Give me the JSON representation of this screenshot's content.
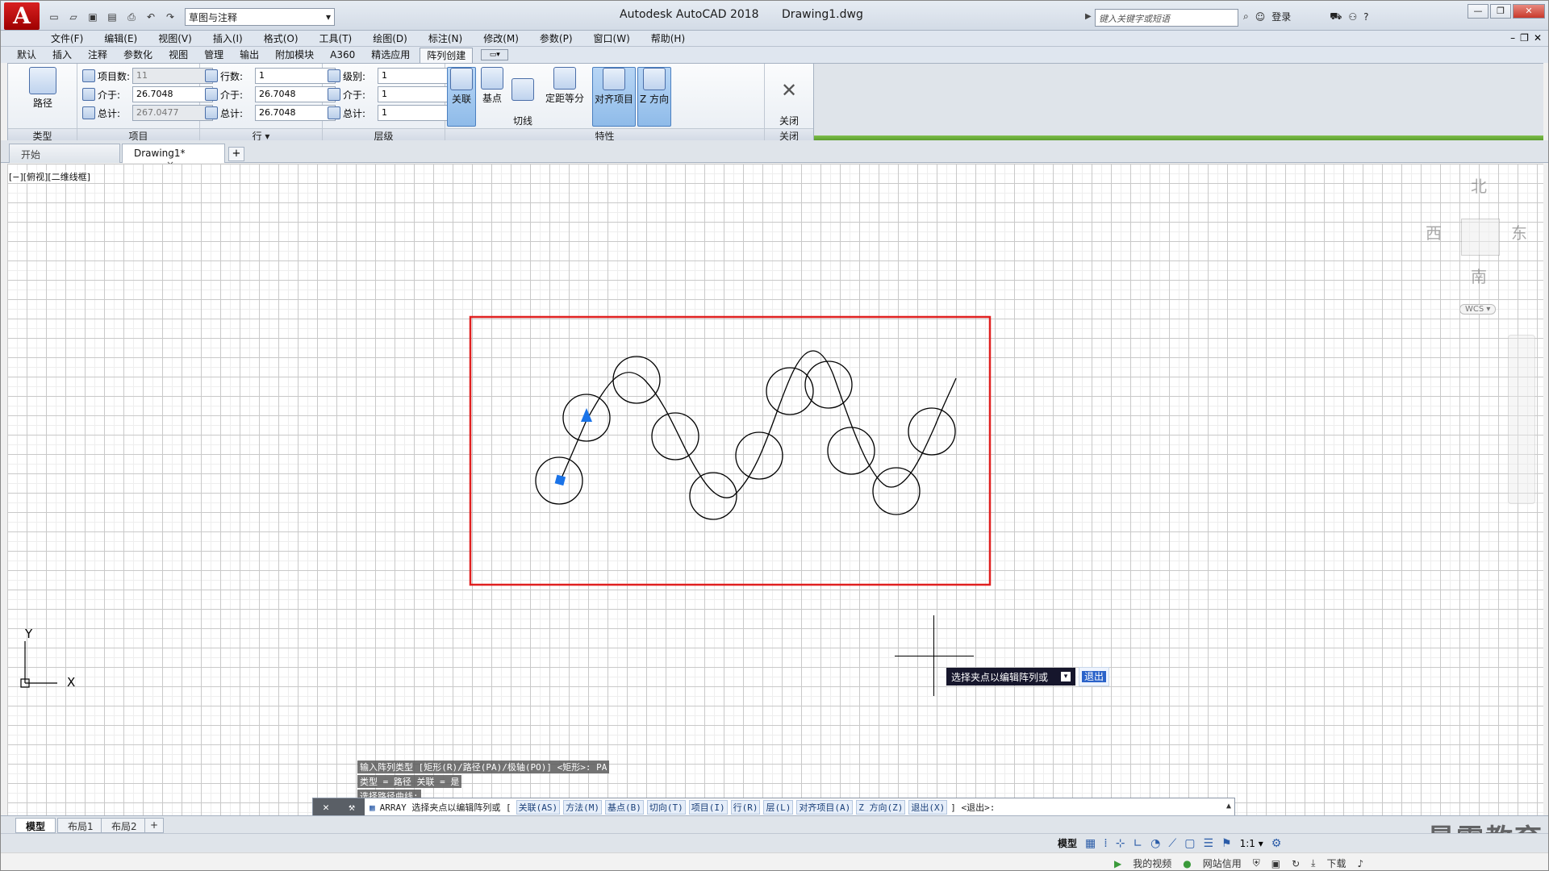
{
  "window": {
    "app_title": "Autodesk AutoCAD 2018",
    "file_name": "Drawing1.dwg",
    "workspace": "草图与注释",
    "search_placeholder": "键入关键字或短语",
    "login": "登录",
    "help": "?"
  },
  "menu": [
    "文件(F)",
    "编辑(E)",
    "视图(V)",
    "插入(I)",
    "格式(O)",
    "工具(T)",
    "绘图(D)",
    "标注(N)",
    "修改(M)",
    "参数(P)",
    "窗口(W)",
    "帮助(H)"
  ],
  "ribbon_tabs": [
    {
      "label": "默认",
      "active": false
    },
    {
      "label": "插入",
      "active": false
    },
    {
      "label": "注释",
      "active": false
    },
    {
      "label": "参数化",
      "active": false
    },
    {
      "label": "视图",
      "active": false
    },
    {
      "label": "管理",
      "active": false
    },
    {
      "label": "输出",
      "active": false
    },
    {
      "label": "附加模块",
      "active": false
    },
    {
      "label": "A360",
      "active": false
    },
    {
      "label": "精选应用",
      "active": false
    },
    {
      "label": "阵列创建",
      "active": true
    }
  ],
  "ribbon": {
    "type_panel": {
      "title": "类型",
      "button": "路径"
    },
    "items_panel": {
      "title": "项目",
      "count_label": "项目数:",
      "count_value": "11",
      "between_label": "介于:",
      "between_value": "26.7048",
      "total_label": "总计:",
      "total_value": "267.0477"
    },
    "rows_panel": {
      "title": "行 ▾",
      "count_label": "行数:",
      "count_value": "1",
      "between_label": "介于:",
      "between_value": "26.7048",
      "total_label": "总计:",
      "total_value": "26.7048"
    },
    "levels_panel": {
      "title": "层级",
      "count_label": "级别:",
      "count_value": "1",
      "between_label": "介于:",
      "between_value": "1",
      "total_label": "总计:",
      "total_value": "1"
    },
    "props_panel": {
      "title": "特性",
      "associative": "关联",
      "base_point": "基点",
      "tangent_dir": "切线\n方向",
      "measure": "定距等分",
      "align_items": "对齐项目",
      "z_dir": "Z 方向"
    },
    "close_panel": {
      "title": "关闭",
      "button": "关闭\n阵列"
    }
  },
  "doc_tabs": [
    {
      "label": "开始",
      "active": false
    },
    {
      "label": "Drawing1*",
      "active": true,
      "close": "×"
    }
  ],
  "viewport_label": "[−][俯视][二维线框]",
  "viewcube": {
    "north": "北",
    "south": "南",
    "east": "东",
    "west": "西",
    "wcs": "WCS ▾"
  },
  "tooltip": {
    "prompt": "选择夹点以编辑阵列或",
    "option": "退出"
  },
  "ucs": {
    "x": "X",
    "y": "Y"
  },
  "command_history": [
    "输入阵列类型 [矩形(R)/路径(PA)/极轴(PO)] <矩形>: PA",
    "类型 = 路径  关联 = 是",
    "选择路径曲线:"
  ],
  "command_line": {
    "prefix": "ARRAY 选择夹点以编辑阵列或 [",
    "options": [
      "关联(AS)",
      "方法(M)",
      "基点(B)",
      "切向(T)",
      "项目(I)",
      "行(R)",
      "层(L)",
      "对齐项目(A)",
      "Z 方向(Z)",
      "退出(X)"
    ],
    "suffix": "] <退出>:"
  },
  "layout_tabs": [
    {
      "label": "模型",
      "active": true
    },
    {
      "label": "布局1",
      "active": false
    },
    {
      "label": "布局2",
      "active": false
    }
  ],
  "status": {
    "model": "模型",
    "scale": "1:1 ▾"
  },
  "watermark": "最需教育",
  "taskbar": {
    "video": "我的视频",
    "credit": "网站信用",
    "download": "下载"
  },
  "colors": {
    "selection_box": "#e02020",
    "grip": "#1a73e8",
    "tooltip_bg": "#16162c"
  }
}
